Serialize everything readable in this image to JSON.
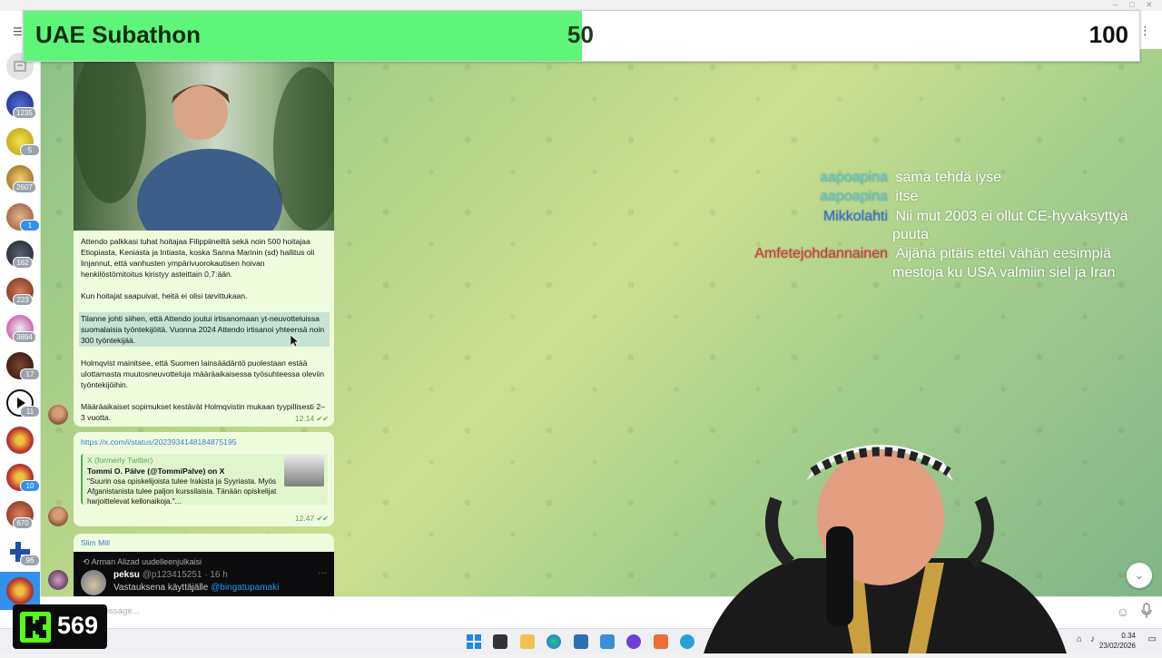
{
  "subathon": {
    "title": "UAE Subathon",
    "current": "50",
    "goal": "100",
    "progress_fraction": 0.5,
    "fill_color": "#5ff57a"
  },
  "sidebar": {
    "chats": [
      {
        "icon": "archive-icon",
        "badge": ""
      },
      {
        "icon": "channel-avatar",
        "badge": "1235"
      },
      {
        "icon": "channel-avatar",
        "badge": "5"
      },
      {
        "icon": "channel-avatar",
        "badge": "2607"
      },
      {
        "icon": "channel-avatar",
        "badge": "1"
      },
      {
        "icon": "channel-avatar",
        "badge": "162"
      },
      {
        "icon": "channel-avatar",
        "badge": "223"
      },
      {
        "icon": "channel-avatar",
        "badge": "3894"
      },
      {
        "icon": "channel-avatar",
        "badge": "17"
      },
      {
        "icon": "channel-avatar",
        "badge": "11"
      },
      {
        "icon": "channel-avatar",
        "badge": ""
      },
      {
        "icon": "channel-avatar",
        "badge": "10"
      },
      {
        "icon": "channel-avatar",
        "badge": "670"
      },
      {
        "icon": "channel-avatar",
        "badge": "96"
      },
      {
        "icon": "channel-avatar",
        "badge": ""
      }
    ]
  },
  "messages": {
    "article": {
      "paragraphs": [
        "Attendo palkkasi tuhat hoitajaa Filippiineiltä sekä noin 500 hoitajaa Etiopiasta, Keniasta ja Intiasta, koska Sanna Marinin (sd) hallitus oli linjannut, että vanhusten ympärivuorokautisen hoivan henkilöstömitoitus kiristyy asteittain 0,7:ään.",
        "Kun hoitajat saapuivat, heitä ei olisi tarvittukaan.",
        "Tilanne johti siihen, että Attendo joutui irtisanomaan yt-neuvotteluissa suomalaisia työntekijöitä. Vuonna 2024 Attendo irtisanoi yhteensä noin 300 työntekijää.",
        "Holmqvist mainitsee, että Suomen lainsäädäntö puolestaan estää ulottamasta muutosneuvotteluja määräaikaisessa työsuhteessa oleviin työntekijöihin.",
        "Määräaikaiset sopimukset kestävät Holmqvistin mukaan tyypillisesti 2–3 vuotta."
      ],
      "time": "12.14"
    },
    "tweet": {
      "url": "https://x.com/i/status/2023934148184875195",
      "site": "X (formerly Twitter)",
      "author": "Tommi O. Pälve (@TommiPalve) on X",
      "text": "\"Suurin osa opiskelijoista tulee Irakista ja Syyriasta. Myös Afganistanista tulee paljon kurssilaisia. Tänään opiskelijat harjoittelevat kellonaikoja.\"...",
      "time": "12.47"
    },
    "forward": {
      "sender": "Slim Mill",
      "repost": "Arman Alizad uudelleenjulkaisi",
      "tweet_author": "peksu",
      "tweet_handle": "@p123415251 · 16 h",
      "reply_to": "Vastauksena käyttäjälle",
      "reply_handle": "@bingatupamaki"
    }
  },
  "input": {
    "placeholder": "essage..."
  },
  "stream_chat": [
    {
      "user": "aapoapina",
      "color": "#58c8d8",
      "text": "sama tehdä iyse"
    },
    {
      "user": "aapoapina",
      "color": "#58c8d8",
      "text": "itse"
    },
    {
      "user": "Mikkolahti",
      "color": "#2f6fe0",
      "text": "Nii mut 2003 ei ollut CE-hyväksyttyä",
      "text2": "puuta"
    },
    {
      "user": "Amfetejohdannainen",
      "color": "#e0303a",
      "text": "Äijänä pitäis ettei vähän eesimpiä",
      "text2": "mestoja ku USA valmiin siel ja Iran"
    }
  ],
  "kick": {
    "viewers": "569",
    "logo_color": "#53fc18"
  },
  "taskbar": {
    "time": "0.34",
    "date": "23/02/2026"
  }
}
